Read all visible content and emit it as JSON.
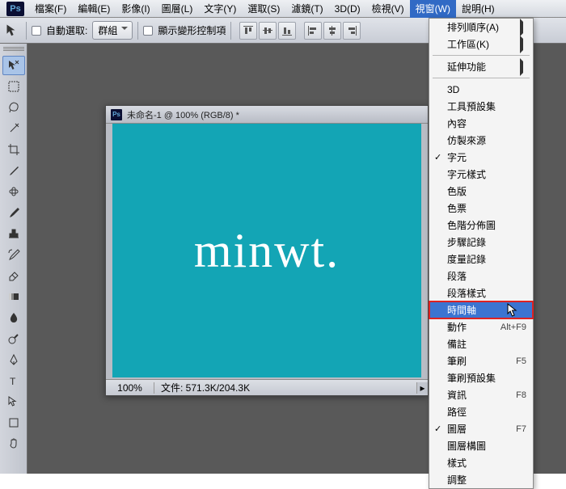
{
  "logo": "Ps",
  "menu": {
    "file": "檔案(F)",
    "edit": "編輯(E)",
    "image": "影像(I)",
    "layer": "圖層(L)",
    "type": "文字(Y)",
    "select": "選取(S)",
    "filter": "濾鏡(T)",
    "threed": "3D(D)",
    "view": "檢視(V)",
    "window": "視窗(W)",
    "help": "說明(H)"
  },
  "options": {
    "autoSelect": "自動選取:",
    "group": "群組",
    "transformControls": "顯示變形控制項"
  },
  "document": {
    "title": "未命名-1 @ 100% (RGB/8) *",
    "zoom": "100%",
    "info": "文件: 571.3K/204.3K",
    "canvasText": "minwt."
  },
  "windowMenu": {
    "arrange": "排列順序(A)",
    "workspace": "工作區(K)",
    "extensions": "延伸功能",
    "threeD": "3D",
    "toolPresets": "工具預設集",
    "content": "內容",
    "cloneSource": "仿製來源",
    "character": "字元",
    "charStyles": "字元樣式",
    "swatches": "色版",
    "color": "色票",
    "histogram": "色階分佈圖",
    "history": "步驟記錄",
    "measurementLog": "度量記錄",
    "paragraph": "段落",
    "paraStyles": "段落樣式",
    "timeline": "時間軸",
    "actions": "動作",
    "actionsShortcut": "Alt+F9",
    "notes": "備註",
    "brush": "筆刷",
    "brushShortcut": "F5",
    "brushPresets": "筆刷預設集",
    "info": "資訊",
    "infoShortcut": "F8",
    "paths": "路徑",
    "layers": "圖層",
    "layersShortcut": "F7",
    "layerComps": "圖層構圖",
    "styles": "樣式",
    "adjustments": "調整"
  }
}
